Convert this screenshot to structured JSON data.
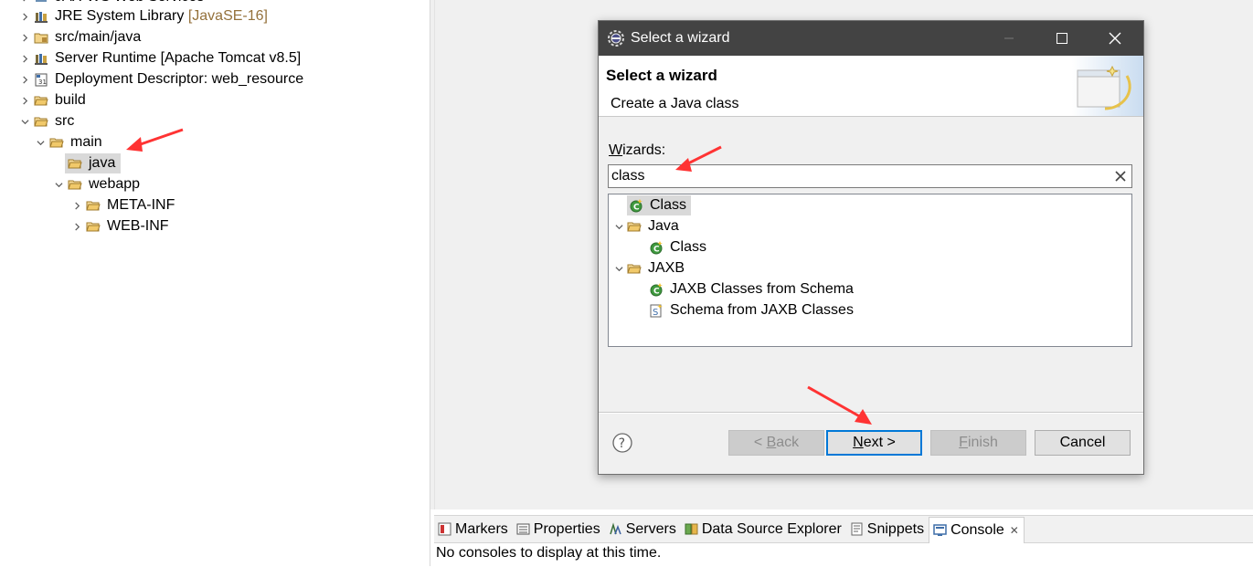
{
  "explorer": {
    "partial_top_label": "JAX-WS Web Services",
    "items": [
      {
        "label": "JRE System Library",
        "suffix": "[JavaSE-16]",
        "icon": "library-icon"
      },
      {
        "label": "src/main/java",
        "icon": "package-folder-icon"
      },
      {
        "label": "Server Runtime [Apache Tomcat v8.5]",
        "icon": "library-icon"
      },
      {
        "label": "Deployment Descriptor: web_resource",
        "icon": "deployment-descriptor-icon"
      },
      {
        "label": "build",
        "icon": "folder-icon"
      },
      {
        "label": "src",
        "icon": "folder-icon"
      },
      {
        "label": "main",
        "icon": "folder-icon"
      },
      {
        "label": "java",
        "icon": "folder-icon"
      },
      {
        "label": "webapp",
        "icon": "folder-icon"
      },
      {
        "label": "META-INF",
        "icon": "folder-icon"
      },
      {
        "label": "WEB-INF",
        "icon": "folder-icon"
      }
    ]
  },
  "dialog": {
    "title": "Select a wizard",
    "banner_title": "Select a wizard",
    "banner_description": "Create a Java class",
    "wizards_label_mnemonic": "W",
    "wizards_label_rest": "izards:",
    "filter_value": "class",
    "tree": [
      {
        "label": "Class",
        "icon": "java-class-icon"
      },
      {
        "label": "Java",
        "icon": "folder-icon"
      },
      {
        "label": "Class",
        "icon": "java-class-icon"
      },
      {
        "label": "JAXB",
        "icon": "folder-icon"
      },
      {
        "label": "JAXB Classes from Schema",
        "icon": "java-class-icon"
      },
      {
        "label": "Schema from JAXB Classes",
        "icon": "schema-icon"
      }
    ],
    "buttons": {
      "back_prefix": "< ",
      "back_mnemonic": "B",
      "back_rest": "ack",
      "next_mnemonic": "N",
      "next_rest": "ext >",
      "finish_mnemonic": "F",
      "finish_rest": "inish",
      "cancel": "Cancel"
    }
  },
  "views": {
    "tabs": [
      {
        "label": "Markers",
        "icon": "markers-icon"
      },
      {
        "label": "Properties",
        "icon": "properties-icon"
      },
      {
        "label": "Servers",
        "icon": "servers-icon"
      },
      {
        "label": "Data Source Explorer",
        "icon": "data-source-icon"
      },
      {
        "label": "Snippets",
        "icon": "snippets-icon"
      },
      {
        "label": "Console",
        "icon": "console-icon",
        "active": true
      }
    ],
    "console_message": "No consoles to display at this time."
  },
  "colors": {
    "annotation_arrow": "#ff3333",
    "title_bar": "#434343",
    "selection": "#d9d9d9",
    "default_button_border": "#0078d7"
  }
}
